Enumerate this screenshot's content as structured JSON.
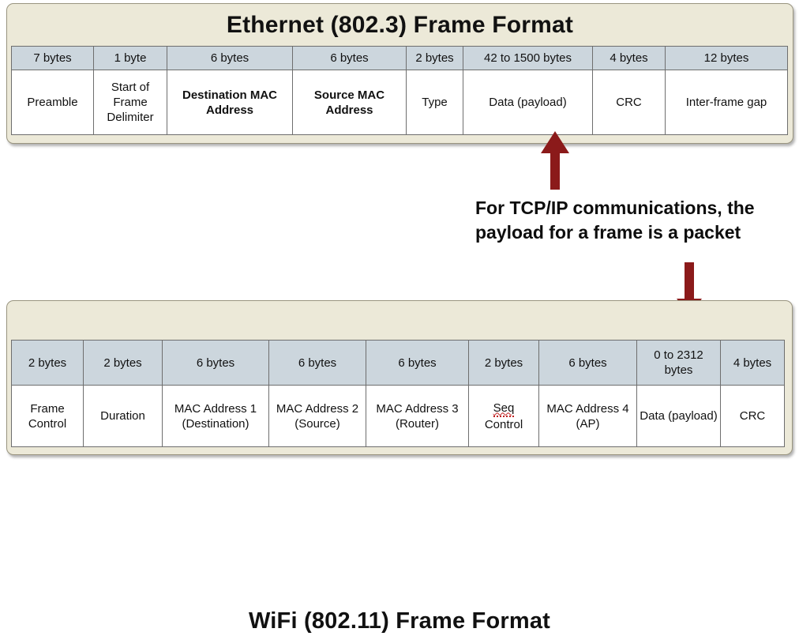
{
  "ethernet": {
    "title": "Ethernet (802.3)  Frame Format",
    "columns": [
      {
        "size": "7 bytes",
        "name": "Preamble",
        "bold": false
      },
      {
        "size": "1 byte",
        "name": "Start of Frame Delimiter",
        "bold": false
      },
      {
        "size": "6 bytes",
        "name": "Destination MAC Address",
        "bold": true
      },
      {
        "size": "6 bytes",
        "name": "Source MAC Address",
        "bold": true
      },
      {
        "size": "2 bytes",
        "name": "Type",
        "bold": false
      },
      {
        "size": "42 to 1500 bytes",
        "name": "Data (payload)",
        "bold": false
      },
      {
        "size": "4 bytes",
        "name": "CRC",
        "bold": false
      },
      {
        "size": "12 bytes",
        "name": "Inter-frame gap",
        "bold": false
      }
    ]
  },
  "wifi": {
    "title": "WiFi (802.11) Frame Format",
    "columns": [
      {
        "size": "2 bytes",
        "name": "Frame Control"
      },
      {
        "size": "2 bytes",
        "name": "Duration"
      },
      {
        "size": "6 bytes",
        "name": "MAC Address 1 (Destination)"
      },
      {
        "size": "6 bytes",
        "name": "MAC Address 2 (Source)"
      },
      {
        "size": "6 bytes",
        "name": "MAC Address 3 (Router)"
      },
      {
        "size": "2 bytes",
        "name": "Seq Control",
        "misspelled_word": "Seq",
        "rest": "Control"
      },
      {
        "size": "6 bytes",
        "name": "MAC Address 4 (AP)"
      },
      {
        "size": "0 to 2312 bytes",
        "name": "Data (payload)"
      },
      {
        "size": "4 bytes",
        "name": "CRC"
      }
    ]
  },
  "annotation": {
    "text": "For TCP/IP communications, the payload for a frame is a packet"
  },
  "colors": {
    "panel_background": "#ece9d8",
    "header_row": "#ccd6dd",
    "cell_background": "#ffffff",
    "arrow": "#8b1a1a",
    "border": "#6e6e6e",
    "spellcheck_underline": "#c02020"
  }
}
